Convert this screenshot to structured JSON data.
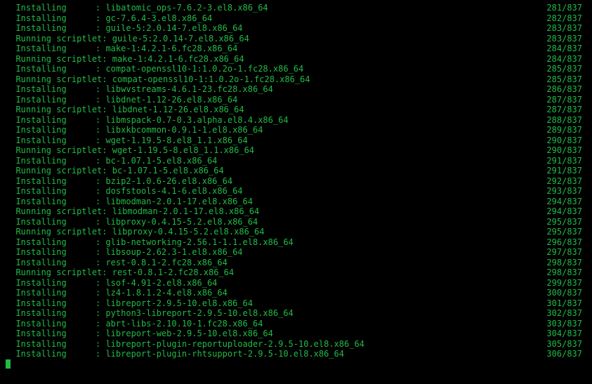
{
  "colors": {
    "fg": "#21ba45",
    "bg": "#000000"
  },
  "total": 837,
  "lines": [
    {
      "action": "Installing",
      "package": "libatomic_ops-7.6.2-3.el8.x86_64",
      "index": 281
    },
    {
      "action": "Installing",
      "package": "gc-7.6.4-3.el8.x86_64",
      "index": 282
    },
    {
      "action": "Installing",
      "package": "guile-5:2.0.14-7.el8.x86_64",
      "index": 283
    },
    {
      "action": "Running scriptlet",
      "package": "guile-5:2.0.14-7.el8.x86_64",
      "index": 283
    },
    {
      "action": "Installing",
      "package": "make-1:4.2.1-6.fc28.x86_64",
      "index": 284
    },
    {
      "action": "Running scriptlet",
      "package": "make-1:4.2.1-6.fc28.x86_64",
      "index": 284
    },
    {
      "action": "Installing",
      "package": "compat-openssl10-1:1.0.2o-1.fc28.x86_64",
      "index": 285
    },
    {
      "action": "Running scriptlet",
      "package": "compat-openssl10-1:1.0.2o-1.fc28.x86_64",
      "index": 285
    },
    {
      "action": "Installing",
      "package": "libwvstreams-4.6.1-23.fc28.x86_64",
      "index": 286
    },
    {
      "action": "Installing",
      "package": "libdnet-1.12-26.el8.x86_64",
      "index": 287
    },
    {
      "action": "Running scriptlet",
      "package": "libdnet-1.12-26.el8.x86_64",
      "index": 287
    },
    {
      "action": "Installing",
      "package": "libmspack-0.7-0.3.alpha.el8.4.x86_64",
      "index": 288
    },
    {
      "action": "Installing",
      "package": "libxkbcommon-0.9.1-1.el8.x86_64",
      "index": 289
    },
    {
      "action": "Installing",
      "package": "wget-1.19.5-8.el8_1.1.x86_64",
      "index": 290
    },
    {
      "action": "Running scriptlet",
      "package": "wget-1.19.5-8.el8_1.1.x86_64",
      "index": 290
    },
    {
      "action": "Installing",
      "package": "bc-1.07.1-5.el8.x86_64",
      "index": 291
    },
    {
      "action": "Running scriptlet",
      "package": "bc-1.07.1-5.el8.x86_64",
      "index": 291
    },
    {
      "action": "Installing",
      "package": "bzip2-1.0.6-26.el8.x86_64",
      "index": 292
    },
    {
      "action": "Installing",
      "package": "dosfstools-4.1-6.el8.x86_64",
      "index": 293
    },
    {
      "action": "Installing",
      "package": "libmodman-2.0.1-17.el8.x86_64",
      "index": 294
    },
    {
      "action": "Running scriptlet",
      "package": "libmodman-2.0.1-17.el8.x86_64",
      "index": 294
    },
    {
      "action": "Installing",
      "package": "libproxy-0.4.15-5.2.el8.x86_64",
      "index": 295
    },
    {
      "action": "Running scriptlet",
      "package": "libproxy-0.4.15-5.2.el8.x86_64",
      "index": 295
    },
    {
      "action": "Installing",
      "package": "glib-networking-2.56.1-1.1.el8.x86_64",
      "index": 296
    },
    {
      "action": "Installing",
      "package": "libsoup-2.62.3-1.el8.x86_64",
      "index": 297
    },
    {
      "action": "Installing",
      "package": "rest-0.8.1-2.fc28.x86_64",
      "index": 298
    },
    {
      "action": "Running scriptlet",
      "package": "rest-0.8.1-2.fc28.x86_64",
      "index": 298
    },
    {
      "action": "Installing",
      "package": "lsof-4.91-2.el8.x86_64",
      "index": 299
    },
    {
      "action": "Installing",
      "package": "lz4-1.8.1.2-4.el8.x86_64",
      "index": 300
    },
    {
      "action": "Installing",
      "package": "libreport-2.9.5-10.el8.x86_64",
      "index": 301
    },
    {
      "action": "Installing",
      "package": "python3-libreport-2.9.5-10.el8.x86_64",
      "index": 302
    },
    {
      "action": "Installing",
      "package": "abrt-libs-2.10.10-1.fc28.x86_64",
      "index": 303
    },
    {
      "action": "Installing",
      "package": "libreport-web-2.9.5-10.el8.x86_64",
      "index": 304
    },
    {
      "action": "Installing",
      "package": "libreport-plugin-reportuploader-2.9.5-10.el8.x86_64",
      "index": 305
    },
    {
      "action": "Installing",
      "package": "libreport-plugin-rhtsupport-2.9.5-10.el8.x86_64",
      "index": 306
    }
  ]
}
